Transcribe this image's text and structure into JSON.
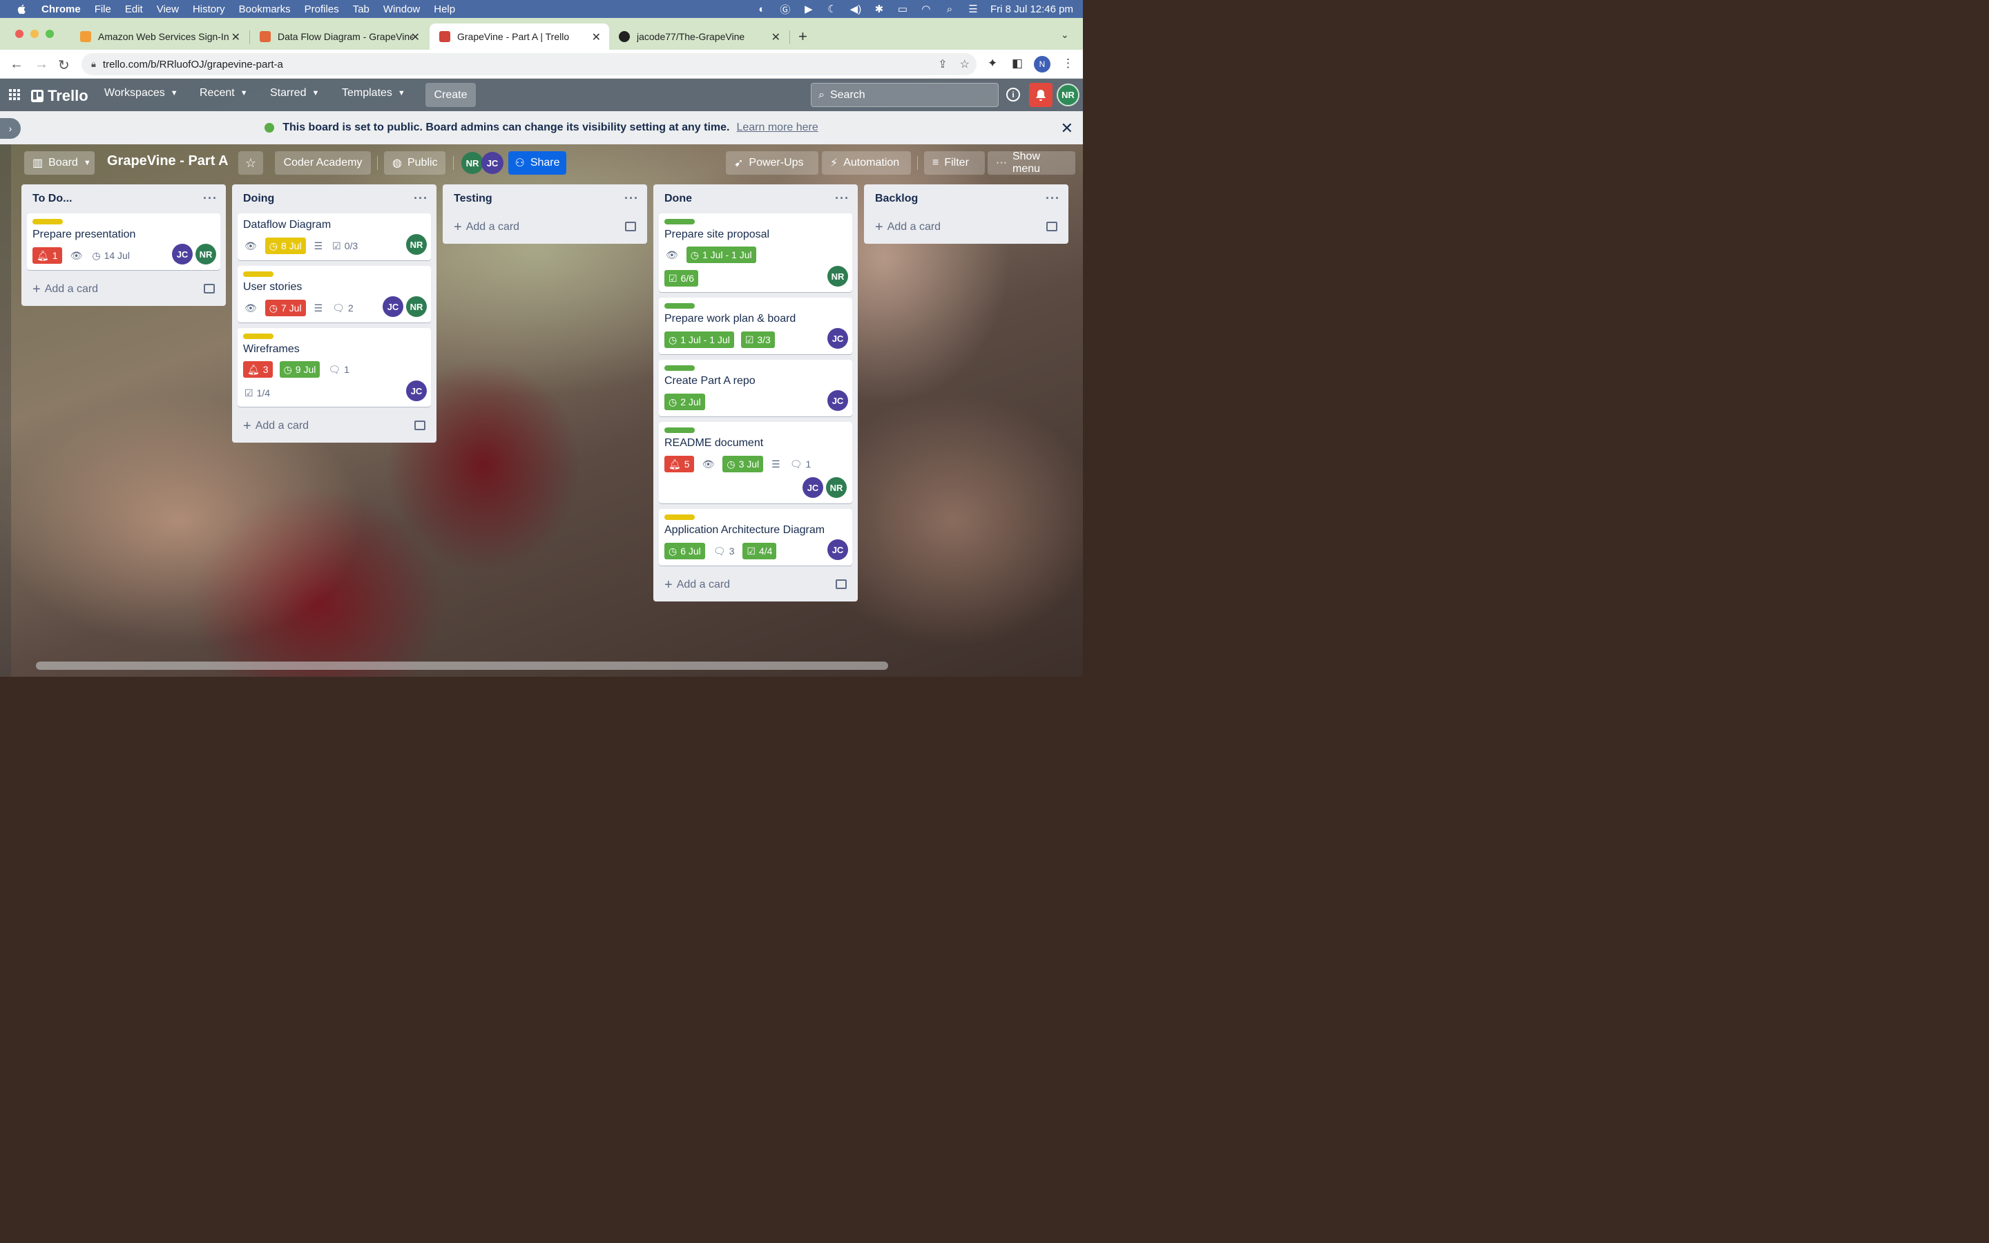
{
  "menubar": {
    "app": "Chrome",
    "items": [
      "File",
      "Edit",
      "View",
      "History",
      "Bookmarks",
      "Profiles",
      "Tab",
      "Window",
      "Help"
    ],
    "clock": "Fri 8 Jul  12:46 pm"
  },
  "tabs": [
    {
      "title": "Amazon Web Services Sign-In",
      "favicon_color": "#f29d38"
    },
    {
      "title": "Data Flow Diagram - GrapeVine",
      "favicon_color": "#e2673a"
    },
    {
      "title": "GrapeVine - Part A | Trello",
      "favicon_color": "#d0443b"
    },
    {
      "title": "jacode77/The-GrapeVine",
      "favicon_color": "#222222"
    }
  ],
  "address": {
    "url": "trello.com/b/RRluofOJ/grapevine-part-a"
  },
  "profile_initial": "N",
  "trello": {
    "logo": "Trello",
    "nav": [
      "Workspaces",
      "Recent",
      "Starred",
      "Templates"
    ],
    "create": "Create",
    "search_placeholder": "Search",
    "avatar": "NR"
  },
  "banner": {
    "message": "This board is set to public. Board admins can change its visibility setting at any time.",
    "link": "Learn more here"
  },
  "board": {
    "view": "Board",
    "title": "GrapeVine - Part A",
    "workspace": "Coder Academy",
    "visibility": "Public",
    "members": [
      "NR",
      "JC"
    ],
    "share": "Share",
    "powerups": "Power-Ups",
    "automation": "Automation",
    "filter": "Filter",
    "menu": "Show menu"
  },
  "add_card": "Add a card",
  "lists": [
    {
      "name": "To Do...",
      "cards": [
        {
          "label": "#e6c60d",
          "title": "Prepare presentation",
          "badges": [
            {
              "kind": "red",
              "icon": "bell",
              "text": "1"
            },
            {
              "kind": "plain",
              "icon": "eye",
              "text": ""
            },
            {
              "kind": "plain",
              "icon": "clock",
              "text": "14 Jul"
            }
          ],
          "members": [
            "JC",
            "NR"
          ]
        }
      ]
    },
    {
      "name": "Doing",
      "cards": [
        {
          "label": "",
          "title": "Dataflow Diagram",
          "badges": [
            {
              "kind": "plain",
              "icon": "eye",
              "text": ""
            },
            {
              "kind": "yellow",
              "icon": "clock",
              "text": "8 Jul"
            },
            {
              "kind": "plain",
              "icon": "desc",
              "text": ""
            },
            {
              "kind": "plain",
              "icon": "check",
              "text": "0/3"
            }
          ],
          "members": [
            "NR"
          ]
        },
        {
          "label": "#e6c60d",
          "title": "User stories",
          "badges": [
            {
              "kind": "plain",
              "icon": "eye",
              "text": ""
            },
            {
              "kind": "red",
              "icon": "clock",
              "text": "7 Jul"
            },
            {
              "kind": "plain",
              "icon": "desc",
              "text": ""
            },
            {
              "kind": "plain",
              "icon": "comment",
              "text": "2"
            }
          ],
          "members": [
            "JC",
            "NR"
          ]
        },
        {
          "label": "#e6c60d",
          "title": "Wireframes",
          "badges": [
            {
              "kind": "red",
              "icon": "bell",
              "text": "3"
            },
            {
              "kind": "green",
              "icon": "clock",
              "text": "9 Jul"
            },
            {
              "kind": "plain",
              "icon": "comment",
              "text": "1"
            },
            {
              "kind": "plain",
              "icon": "check",
              "text": "1/4"
            }
          ],
          "members": [
            "JC"
          ]
        }
      ]
    },
    {
      "name": "Testing",
      "cards": []
    },
    {
      "name": "Done",
      "cards": [
        {
          "label": "#5aac44",
          "title": "Prepare site proposal",
          "badges": [
            {
              "kind": "plain",
              "icon": "eye",
              "text": ""
            },
            {
              "kind": "green",
              "icon": "clock",
              "text": "1 Jul - 1 Jul"
            },
            {
              "kind": "green",
              "icon": "check",
              "text": "6/6"
            }
          ],
          "members": [
            "NR"
          ]
        },
        {
          "label": "#5aac44",
          "title": "Prepare work plan & board",
          "badges": [
            {
              "kind": "green",
              "icon": "clock",
              "text": "1 Jul - 1 Jul"
            },
            {
              "kind": "green",
              "icon": "check",
              "text": "3/3"
            }
          ],
          "members": [
            "JC"
          ]
        },
        {
          "label": "#5aac44",
          "title": "Create Part A repo",
          "badges": [
            {
              "kind": "green",
              "icon": "clock",
              "text": "2 Jul"
            }
          ],
          "members": [
            "JC"
          ]
        },
        {
          "label": "#5aac44",
          "title": "README document",
          "badges": [
            {
              "kind": "red",
              "icon": "bell",
              "text": "5"
            },
            {
              "kind": "plain",
              "icon": "eye",
              "text": ""
            },
            {
              "kind": "green",
              "icon": "clock",
              "text": "3 Jul"
            },
            {
              "kind": "plain",
              "icon": "desc",
              "text": ""
            },
            {
              "kind": "plain",
              "icon": "comment",
              "text": "1"
            }
          ],
          "members": [
            "JC",
            "NR"
          ],
          "members_below": true
        },
        {
          "label": "#e6c60d",
          "title": "Application Architecture Diagram",
          "badges": [
            {
              "kind": "green",
              "icon": "clock",
              "text": "6 Jul"
            },
            {
              "kind": "plain",
              "icon": "comment",
              "text": "3"
            },
            {
              "kind": "green",
              "icon": "check",
              "text": "4/4"
            }
          ],
          "members": [
            "JC"
          ]
        }
      ]
    },
    {
      "name": "Backlog",
      "cards": []
    }
  ]
}
